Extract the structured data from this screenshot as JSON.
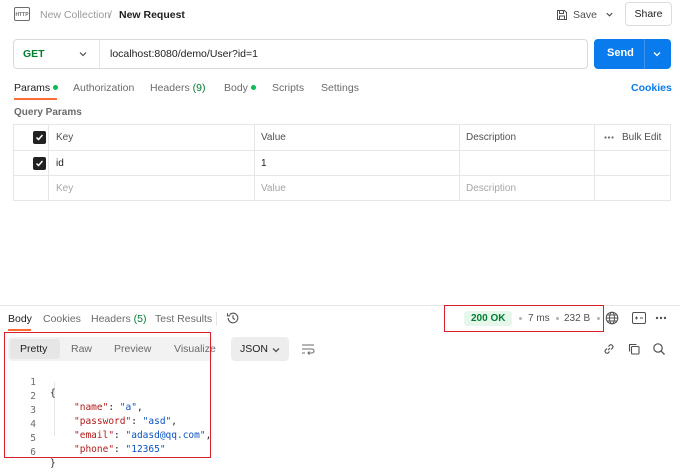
{
  "header": {
    "http_icon": "http-icon",
    "collection": "New Collection",
    "separator": "/",
    "request_name": "New Request",
    "save_label": "Save",
    "share_label": "Share"
  },
  "url_bar": {
    "method": "GET",
    "url": "localhost:8080/demo/User?id=1",
    "send_label": "Send",
    "method_color": "#007f31",
    "send_color": "#097bed"
  },
  "request_tabs": [
    {
      "label": "Params",
      "active": true,
      "dot": true
    },
    {
      "label": "Authorization"
    },
    {
      "label": "Headers",
      "count": "(9)"
    },
    {
      "label": "Body",
      "dot": true
    },
    {
      "label": "Scripts"
    },
    {
      "label": "Settings"
    }
  ],
  "cookies_label": "Cookies",
  "query_params": {
    "title": "Query Params",
    "headers": {
      "key": "Key",
      "value": "Value",
      "description": "Description",
      "bulk_edit": "Bulk Edit"
    },
    "rows": [
      {
        "checked": true,
        "key": "id",
        "value": "1",
        "description": ""
      }
    ],
    "placeholder": {
      "key": "Key",
      "value": "Value",
      "description": "Description"
    }
  },
  "response": {
    "tabs": [
      {
        "label": "Body",
        "active": true
      },
      {
        "label": "Cookies"
      },
      {
        "label": "Headers",
        "count": "(5)"
      },
      {
        "label": "Test Results"
      }
    ],
    "status": "200 OK",
    "time": "7 ms",
    "size": "232 B",
    "status_color": "#007f31",
    "formats": [
      "Pretty",
      "Raw",
      "Preview",
      "Visualize"
    ],
    "active_format": "Pretty",
    "language": "JSON",
    "code_lines": [
      {
        "n": "1",
        "text": "{"
      },
      {
        "n": "2",
        "key": "\"name\"",
        "val": "\"a\"",
        "comma": ","
      },
      {
        "n": "3",
        "key": "\"password\"",
        "val": "\"asd\"",
        "comma": ","
      },
      {
        "n": "4",
        "key": "\"email\"",
        "val": "\"adasd@qq.com\"",
        "comma": ","
      },
      {
        "n": "5",
        "key": "\"phone\"",
        "val": "\"12365\"",
        "comma": ""
      },
      {
        "n": "6",
        "text": "}"
      }
    ]
  }
}
